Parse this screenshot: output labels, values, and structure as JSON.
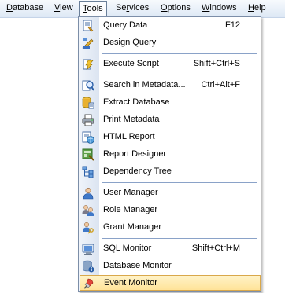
{
  "menubar": {
    "items": [
      {
        "label": "Database",
        "mnemonic": "D"
      },
      {
        "label": "View",
        "mnemonic": "V"
      },
      {
        "label": "Tools",
        "mnemonic": "T"
      },
      {
        "label": "Services",
        "mnemonic": "r"
      },
      {
        "label": "Options",
        "mnemonic": "O"
      },
      {
        "label": "Windows",
        "mnemonic": "W"
      },
      {
        "label": "Help",
        "mnemonic": "H"
      }
    ],
    "active": "Tools"
  },
  "tools_menu": {
    "items": [
      {
        "label": "Query Data",
        "shortcut": "F12",
        "icon": "query-data-icon"
      },
      {
        "label": "Design Query",
        "shortcut": "",
        "icon": "design-query-icon"
      },
      {
        "label": "Execute Script",
        "shortcut": "Shift+Ctrl+S",
        "icon": "execute-script-icon"
      },
      {
        "label": "Search in Metadata...",
        "shortcut": "Ctrl+Alt+F",
        "icon": "search-metadata-icon"
      },
      {
        "label": "Extract Database",
        "shortcut": "",
        "icon": "extract-database-icon"
      },
      {
        "label": "Print Metadata",
        "shortcut": "",
        "icon": "printer-icon"
      },
      {
        "label": "HTML Report",
        "shortcut": "",
        "icon": "html-report-icon"
      },
      {
        "label": "Report Designer",
        "shortcut": "",
        "icon": "report-designer-icon"
      },
      {
        "label": "Dependency Tree",
        "shortcut": "",
        "icon": "dependency-tree-icon"
      },
      {
        "label": "User Manager",
        "shortcut": "",
        "icon": "user-manager-icon"
      },
      {
        "label": "Role Manager",
        "shortcut": "",
        "icon": "role-manager-icon"
      },
      {
        "label": "Grant Manager",
        "shortcut": "",
        "icon": "grant-manager-icon"
      },
      {
        "label": "SQL Monitor",
        "shortcut": "Shift+Ctrl+M",
        "icon": "sql-monitor-icon"
      },
      {
        "label": "Database Monitor",
        "shortcut": "",
        "icon": "database-monitor-icon"
      },
      {
        "label": "Event Monitor",
        "shortcut": "",
        "icon": "event-monitor-icon"
      }
    ],
    "highlighted": "Event Monitor"
  },
  "colors": {
    "menubar_bg": "#dde8f5",
    "icon_strip": "#dbe4f1",
    "separator": "#8aa2c8",
    "highlight_fill": "#ffe398",
    "highlight_border": "#d9a84b"
  }
}
